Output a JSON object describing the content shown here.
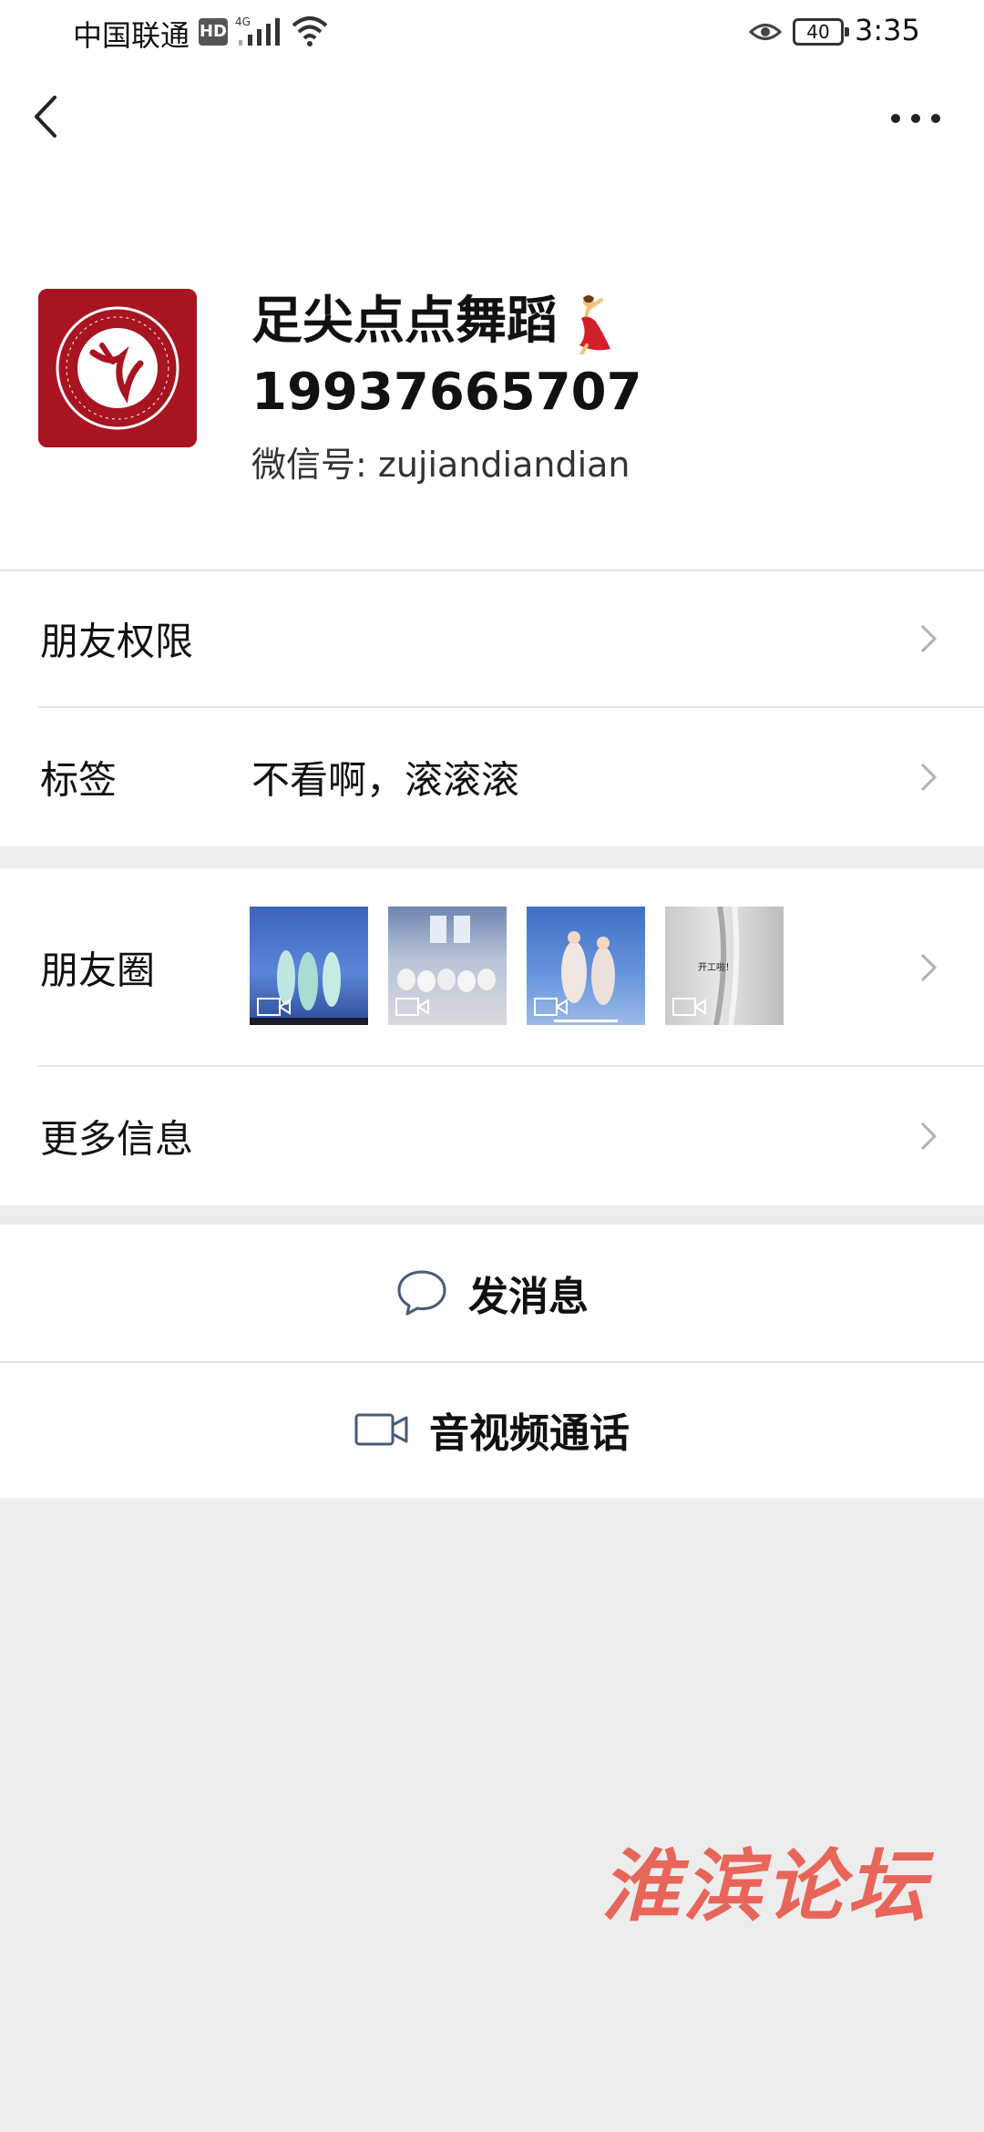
{
  "status_bar": {
    "carrier": "中国联通",
    "hd_badge": "HD",
    "network": "4G",
    "battery": "40",
    "time": "3:35"
  },
  "nav": {
    "back_icon": "chevron-left-icon",
    "more_icon": "more-dots-icon"
  },
  "profile": {
    "name": "足尖点点舞蹈",
    "name_emoji": "dancer-emoji",
    "phone": "19937665707",
    "wechat_id_label": "微信号:",
    "wechat_id": "zujiandiandian",
    "avatar_color": "#a81420"
  },
  "cells_group1": [
    {
      "label": "朋友权限",
      "value": ""
    },
    {
      "label": "标签",
      "value": "不看啊，滚滚滚"
    }
  ],
  "moments": {
    "label": "朋友圈",
    "thumbnails": [
      {
        "kind": "video",
        "caption": ""
      },
      {
        "kind": "video",
        "caption": ""
      },
      {
        "kind": "video",
        "caption": ""
      },
      {
        "kind": "video",
        "caption": "开工啦！"
      }
    ]
  },
  "more_info": {
    "label": "更多信息"
  },
  "actions": {
    "message": {
      "label": "发消息",
      "icon": "chat-bubble-icon"
    },
    "call": {
      "label": "音视频通话",
      "icon": "video-camera-icon"
    }
  },
  "watermark": "淮滨论坛",
  "colors": {
    "background": "#ededed",
    "panel": "#ffffff",
    "watermark": "#e8584a",
    "chevron": "#b2b2b2"
  }
}
